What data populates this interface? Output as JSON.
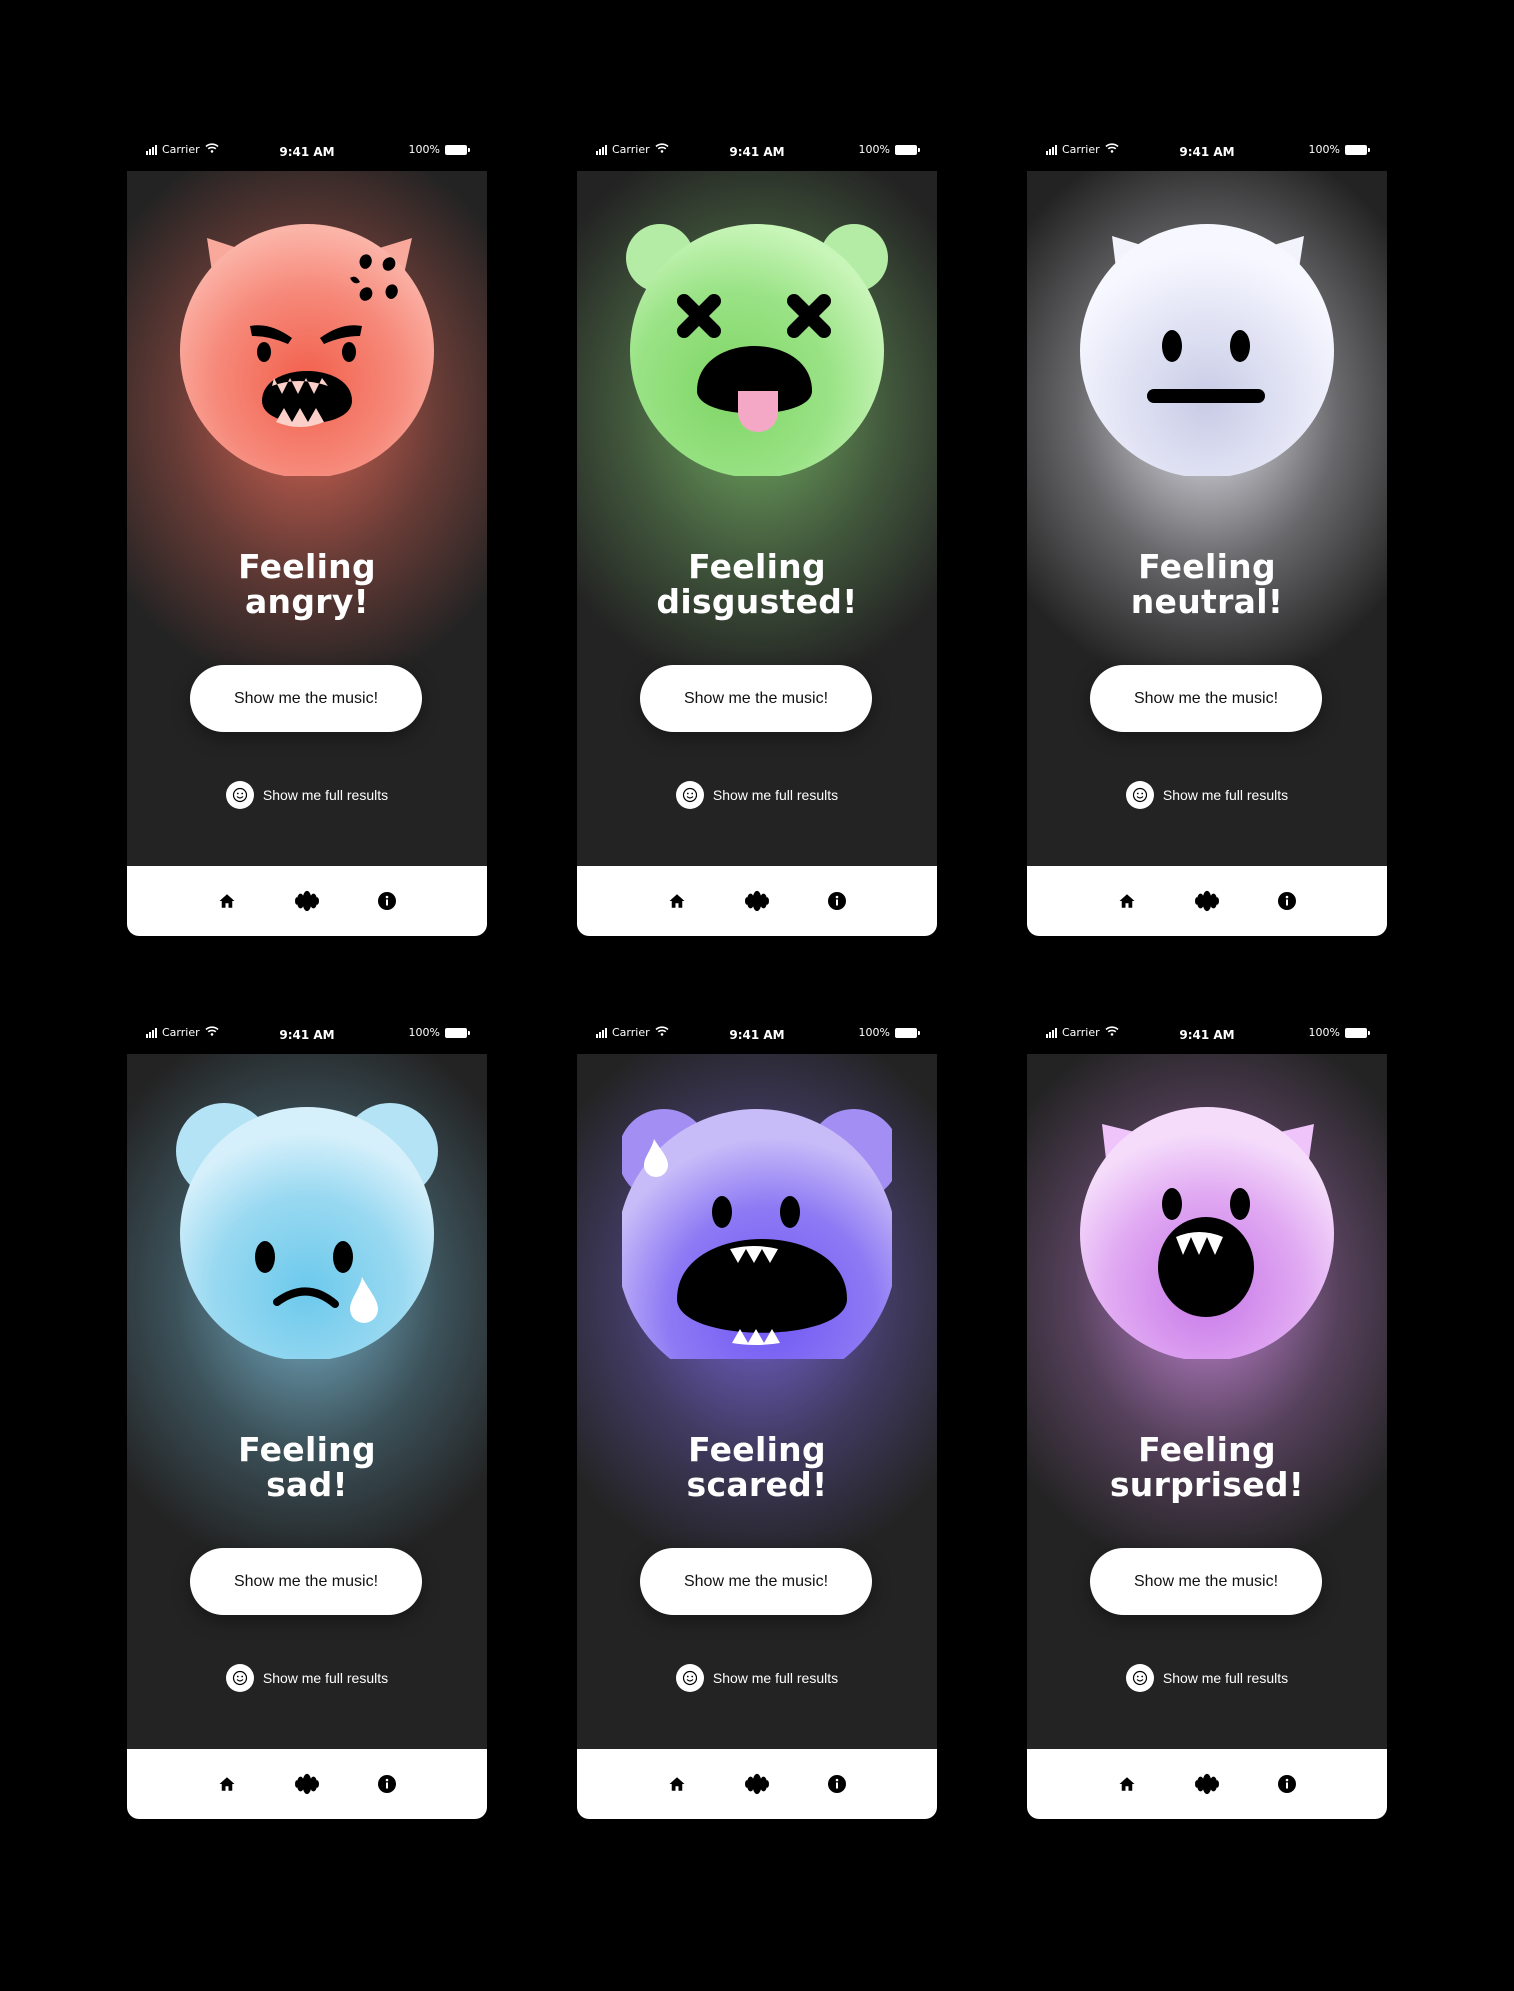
{
  "status_bar": {
    "carrier": "Carrier",
    "time": "9:41 AM",
    "battery": "100%"
  },
  "screens": [
    {
      "mood": "angry",
      "title_line1": "Feeling",
      "title_line2": "angry!",
      "music_button": "Show me the music!",
      "results_link": "Show me full results",
      "accent": "#f07a66"
    },
    {
      "mood": "disgusted",
      "title_line1": "Feeling",
      "title_line2": "disgusted!",
      "music_button": "Show me the music!",
      "results_link": "Show me full results",
      "accent": "#8fdc7a"
    },
    {
      "mood": "neutral",
      "title_line1": "Feeling",
      "title_line2": "neutral!",
      "music_button": "Show me the music!",
      "results_link": "Show me full results",
      "accent": "#e8eaf6"
    },
    {
      "mood": "sad",
      "title_line1": "Feeling",
      "title_line2": "sad!",
      "music_button": "Show me the music!",
      "results_link": "Show me full results",
      "accent": "#8fd3ee"
    },
    {
      "mood": "scared",
      "title_line1": "Feeling",
      "title_line2": "scared!",
      "music_button": "Show me the music!",
      "results_link": "Show me full results",
      "accent": "#8f7bf3"
    },
    {
      "mood": "surprised",
      "title_line1": "Feeling",
      "title_line2": "surprised!",
      "music_button": "Show me the music!",
      "results_link": "Show me full results",
      "accent": "#dd9df0"
    }
  ],
  "nav": {
    "icons": [
      "home-icon",
      "waveform-icon",
      "info-icon"
    ]
  }
}
